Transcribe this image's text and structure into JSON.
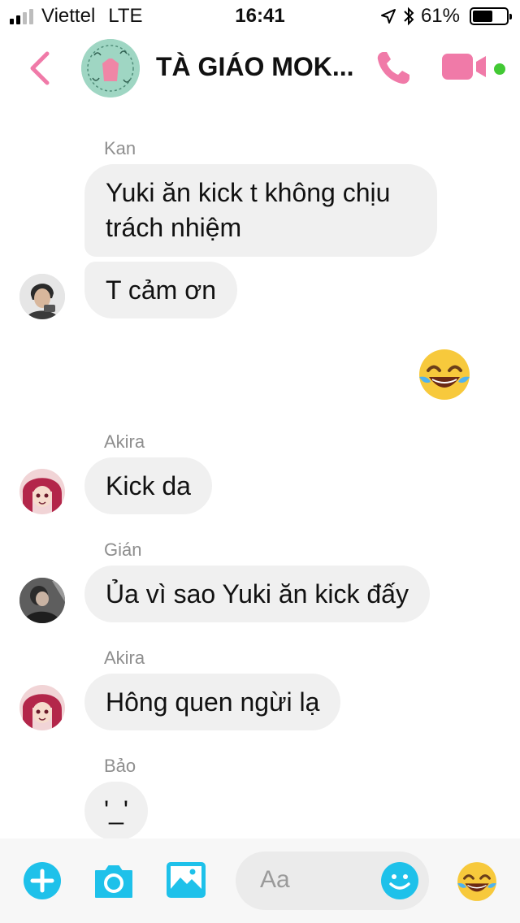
{
  "status_bar": {
    "carrier": "Viettel",
    "network": "LTE",
    "time": "16:41",
    "battery_label": "61%",
    "battery_level": 0.61
  },
  "header": {
    "title": "TÀ GIÁO MOK...",
    "accent_color": "#f07aa8",
    "online_color": "#42c934"
  },
  "messages": [
    {
      "sender": "Kan",
      "bubbles": [
        "Yuki ăn kick t không chịu",
        "trách nhiệm",
        "T cảm ơn"
      ]
    },
    {
      "emoji": "face-with-tears-of-joy-icon"
    },
    {
      "sender": "Akira",
      "bubbles": [
        "Kick da"
      ]
    },
    {
      "sender": "Gián",
      "bubbles": [
        "Ủa vì sao Yuki ăn kick đấy"
      ]
    },
    {
      "sender": "Akira",
      "bubbles": [
        "Hông quen ngừi lạ"
      ]
    },
    {
      "sender": "Bảo",
      "bubbles": [
        "'_'"
      ]
    }
  ],
  "composer": {
    "placeholder": "Aa",
    "accent_color": "#1ec1ea",
    "icons": [
      "plus-icon",
      "camera-icon",
      "gallery-icon",
      "smiley-icon",
      "face-with-tears-of-joy-icon"
    ]
  }
}
